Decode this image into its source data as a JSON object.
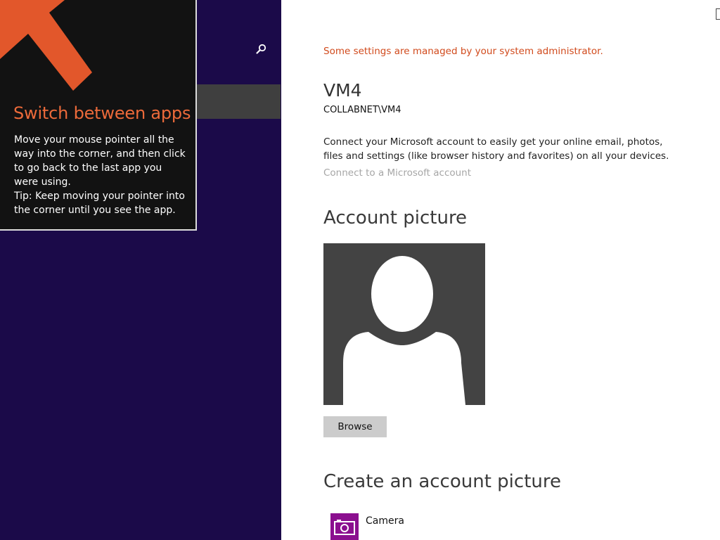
{
  "tip": {
    "title": "Switch between apps",
    "body_line1": "Move your mouse pointer all the way into the corner, and then click to go back to the last app you were using.",
    "body_line2": "Tip: Keep moving your pointer into the corner until you see the app."
  },
  "left_pane": {
    "search_icon": "search-icon"
  },
  "account": {
    "admin_warning": "Some settings are managed by your system administrator.",
    "user_name": "VM4",
    "user_domain": "COLLABNET\\VM4",
    "connect_description": "Connect your Microsoft account to easily get your online email, photos, files and settings (like browser history and favorites) on all your devices.",
    "connect_link": "Connect to a Microsoft account",
    "picture_heading": "Account picture",
    "browse_label": "Browse",
    "create_heading": "Create an account picture",
    "camera_label": "Camera"
  },
  "colors": {
    "left_pane_bg": "#1b0a49",
    "tip_title": "#ec6a3a",
    "admin_warning": "#d14a1c",
    "camera_tile": "#8b0f8f"
  }
}
